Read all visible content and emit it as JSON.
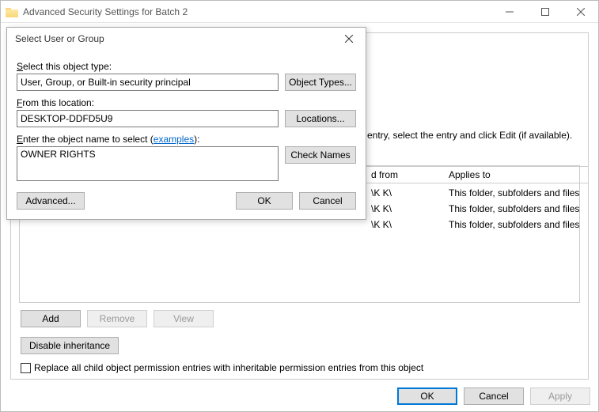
{
  "parent": {
    "title": "Advanced Security Settings for Batch 2",
    "info_text": "entry, select the entry and click Edit (if available).",
    "table": {
      "col_inherited": "d from",
      "col_applies": "Applies to",
      "rows": [
        {
          "inherited": "\\K K\\",
          "applies": "This folder, subfolders and files"
        },
        {
          "inherited": "\\K K\\",
          "applies": "This folder, subfolders and files"
        },
        {
          "inherited": "\\K K\\",
          "applies": "This folder, subfolders and files"
        }
      ]
    },
    "buttons": {
      "add": "Add",
      "remove": "Remove",
      "view": "View",
      "disable_inheritance": "Disable inheritance",
      "ok": "OK",
      "cancel": "Cancel",
      "apply": "Apply"
    },
    "replace_label": "Replace all child object permission entries with inheritable permission entries from this object"
  },
  "dialog": {
    "title": "Select User or Group",
    "object_type_label": "Select this object type:",
    "object_type_value": "User, Group, or Built-in security principal",
    "object_types_btn": "Object Types...",
    "location_label": "From this location:",
    "location_value": "DESKTOP-DDFD5U9",
    "locations_btn": "Locations...",
    "enter_name_label_pre": "Enter the object name to select (",
    "enter_name_link": "examples",
    "enter_name_label_post": "):",
    "object_name_value": "OWNER RIGHTS",
    "check_names_btn": "Check Names",
    "advanced_btn": "Advanced...",
    "ok_btn": "OK",
    "cancel_btn": "Cancel"
  }
}
